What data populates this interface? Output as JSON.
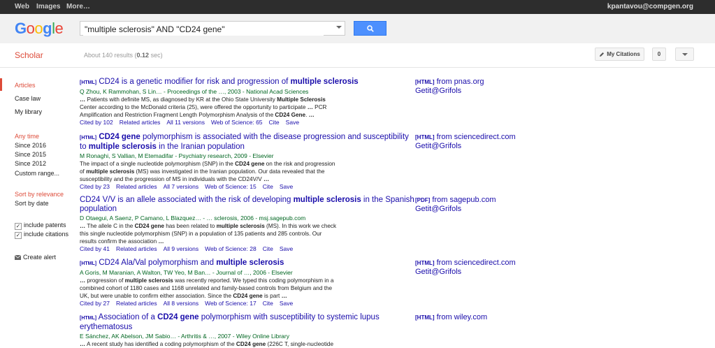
{
  "topbar": {
    "web": "Web",
    "images": "Images",
    "more": "More…",
    "user": "kpantavou@compgen.org"
  },
  "search": {
    "query": "\"multiple sclerosis\" AND \"CD24 gene\""
  },
  "subbar": {
    "scholar": "Scholar",
    "results_pre": "About 140 results (",
    "results_time": "0.12",
    "results_post": " sec)",
    "my_citations": "My Citations",
    "count": "0"
  },
  "sidebar": {
    "articles": "Articles",
    "case_law": "Case law",
    "my_library": "My library",
    "any_time": "Any time",
    "since2016": "Since 2016",
    "since2015": "Since 2015",
    "since2012": "Since 2012",
    "custom": "Custom range...",
    "sort_relevance": "Sort by relevance",
    "sort_date": "Sort by date",
    "include_patents": "include patents",
    "include_citations": "include citations",
    "create_alert": "Create alert"
  },
  "results": [
    {
      "tag": "[HTML]",
      "title": "CD24 is a genetic modifier for risk and progression of",
      "title_b": "multiple sclerosis",
      "authors": "Q Zhou, K Rammohan, S Lin… - Proceedings of the …, 2003 - National Acad Sciences",
      "cited": "Cited by 102",
      "related": "Related articles",
      "versions": "All 11 versions",
      "wos": "Web of Science: 65",
      "cite": "Cite",
      "save": "Save",
      "side_tag": "[HTML]",
      "side": "from pnas.org",
      "side2": "Getit@Grifols"
    },
    {
      "tag": "[HTML]",
      "authors": "M Ronaghi, S Vallian, M Etemadifar - Psychiatry research, 2009 - Elsevier",
      "cited": "Cited by 23",
      "related": "Related articles",
      "versions": "All 7 versions",
      "wos": "Web of Science: 15",
      "cite": "Cite",
      "save": "Save",
      "side_tag": "[HTML]",
      "side": "from sciencedirect.com",
      "side2": "Getit@Grifols"
    },
    {
      "authors": "D Otaegui, A Saenz, P Camano, L Blazquez… - … sclerosis, 2006 - msj.sagepub.com",
      "cited": "Cited by 41",
      "related": "Related articles",
      "versions": "All 9 versions",
      "wos": "Web of Science: 28",
      "cite": "Cite",
      "save": "Save",
      "side_tag": "[PDF]",
      "side": "from sagepub.com",
      "side2": "Getit@Grifols"
    },
    {
      "tag": "[HTML]",
      "title": "CD24 Ala/Val polymorphism and",
      "title_b": "multiple sclerosis",
      "authors": "A Goris, M Maranian, A Walton, TW Yeo, M Ban… - Journal of …, 2006 - Elsevier",
      "cited": "Cited by 27",
      "related": "Related articles",
      "versions": "All 8 versions",
      "wos": "Web of Science: 17",
      "cite": "Cite",
      "save": "Save",
      "side_tag": "[HTML]",
      "side": "from sciencedirect.com",
      "side2": "Getit@Grifols"
    },
    {
      "tag": "[HTML]",
      "authors": "E Sánchez, AK Abelson, JM Sabio… - Arthritis & …, 2007 - Wiley Online Library",
      "side_tag": "[HTML]",
      "side": "from wiley.com"
    }
  ]
}
